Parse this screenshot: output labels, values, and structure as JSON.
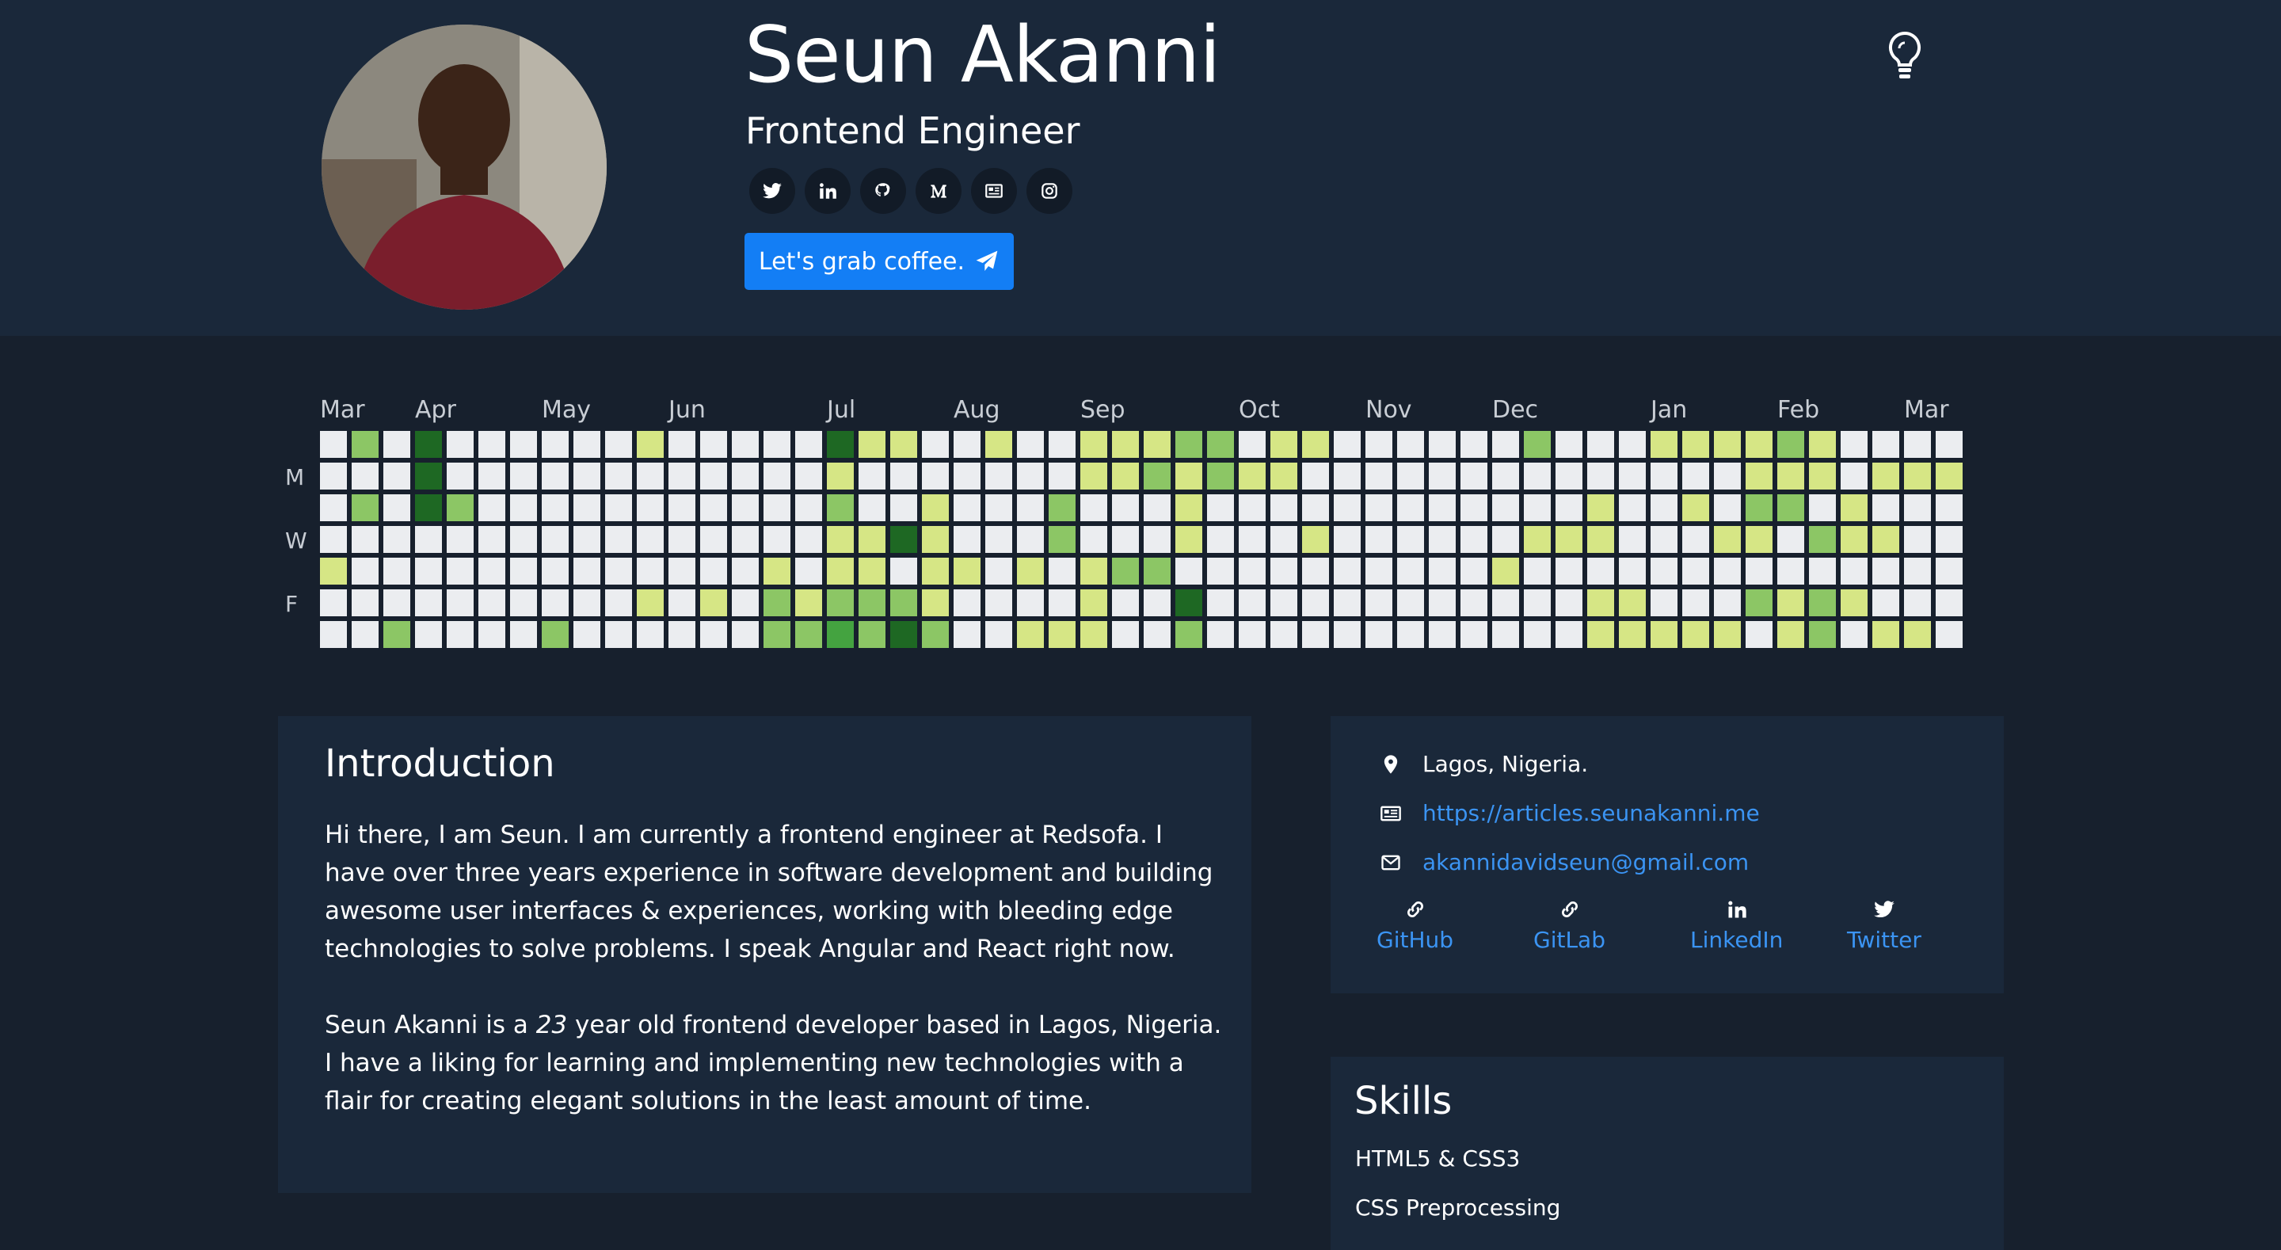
{
  "profile": {
    "name": "Seun Akanni",
    "role": "Frontend Engineer",
    "cta_label": "Let's grab coffee.",
    "socials": [
      "twitter-icon",
      "linkedin-icon",
      "github-icon",
      "medium-icon",
      "articles-icon",
      "instagram-icon"
    ]
  },
  "calendar": {
    "months": [
      "Mar",
      "Apr",
      "May",
      "Jun",
      "Jul",
      "Aug",
      "Sep",
      "Oct",
      "Nov",
      "Dec",
      "Jan",
      "Feb",
      "Mar"
    ],
    "day_labels": [
      "M",
      "W",
      "F"
    ],
    "level_colors": [
      "#ebedf0",
      "#d6e685",
      "#8cc665",
      "#44a340",
      "#1e6823"
    ],
    "weeks": [
      [
        0,
        0,
        0,
        0,
        1,
        0,
        0
      ],
      [
        2,
        0,
        2,
        0,
        0,
        0,
        0
      ],
      [
        0,
        0,
        0,
        0,
        0,
        0,
        2
      ],
      [
        4,
        4,
        4,
        0,
        0,
        0,
        0
      ],
      [
        0,
        0,
        2,
        0,
        0,
        0,
        0
      ],
      [
        0,
        0,
        0,
        0,
        0,
        0,
        0
      ],
      [
        0,
        0,
        0,
        0,
        0,
        0,
        0
      ],
      [
        0,
        0,
        0,
        0,
        0,
        0,
        2
      ],
      [
        0,
        0,
        0,
        0,
        0,
        0,
        0
      ],
      [
        0,
        0,
        0,
        0,
        0,
        0,
        0
      ],
      [
        1,
        0,
        0,
        0,
        0,
        1,
        0
      ],
      [
        0,
        0,
        0,
        0,
        0,
        0,
        0
      ],
      [
        0,
        0,
        0,
        0,
        0,
        1,
        0
      ],
      [
        0,
        0,
        0,
        0,
        0,
        0,
        0
      ],
      [
        0,
        0,
        0,
        0,
        1,
        2,
        2
      ],
      [
        0,
        0,
        0,
        0,
        0,
        1,
        2
      ],
      [
        4,
        1,
        2,
        1,
        1,
        2,
        3
      ],
      [
        1,
        0,
        0,
        1,
        1,
        2,
        2
      ],
      [
        1,
        0,
        0,
        4,
        0,
        2,
        4
      ],
      [
        0,
        0,
        1,
        1,
        1,
        1,
        2
      ],
      [
        0,
        0,
        0,
        0,
        1,
        0,
        0
      ],
      [
        1,
        0,
        0,
        0,
        0,
        0,
        0
      ],
      [
        0,
        0,
        0,
        0,
        1,
        0,
        1
      ],
      [
        0,
        0,
        2,
        2,
        0,
        0,
        1
      ],
      [
        1,
        1,
        0,
        0,
        1,
        1,
        1
      ],
      [
        1,
        1,
        0,
        0,
        2,
        0,
        0
      ],
      [
        1,
        2,
        0,
        0,
        2,
        0,
        0
      ],
      [
        2,
        1,
        1,
        1,
        0,
        4,
        2
      ],
      [
        2,
        2,
        0,
        0,
        0,
        0,
        0
      ],
      [
        0,
        1,
        0,
        0,
        0,
        0,
        0
      ],
      [
        1,
        1,
        0,
        0,
        0,
        0,
        0
      ],
      [
        1,
        0,
        0,
        1,
        0,
        0,
        0
      ],
      [
        0,
        0,
        0,
        0,
        0,
        0,
        0
      ],
      [
        0,
        0,
        0,
        0,
        0,
        0,
        0
      ],
      [
        0,
        0,
        0,
        0,
        0,
        0,
        0
      ],
      [
        0,
        0,
        0,
        0,
        0,
        0,
        0
      ],
      [
        0,
        0,
        0,
        0,
        0,
        0,
        0
      ],
      [
        0,
        0,
        0,
        0,
        1,
        0,
        0
      ],
      [
        2,
        0,
        0,
        1,
        0,
        0,
        0
      ],
      [
        0,
        0,
        0,
        1,
        0,
        0,
        0
      ],
      [
        0,
        0,
        1,
        1,
        0,
        1,
        1
      ],
      [
        0,
        0,
        0,
        0,
        0,
        1,
        1
      ],
      [
        1,
        0,
        0,
        0,
        0,
        0,
        1
      ],
      [
        1,
        0,
        1,
        0,
        0,
        0,
        1
      ],
      [
        1,
        0,
        0,
        1,
        0,
        0,
        1
      ],
      [
        1,
        1,
        2,
        1,
        0,
        2,
        0
      ],
      [
        2,
        1,
        2,
        0,
        0,
        1,
        1
      ],
      [
        1,
        1,
        0,
        2,
        0,
        2,
        2
      ],
      [
        0,
        0,
        1,
        1,
        0,
        1,
        0
      ],
      [
        0,
        1,
        0,
        1,
        0,
        0,
        1
      ],
      [
        0,
        1,
        0,
        0,
        0,
        0,
        1
      ],
      [
        0,
        1,
        0,
        0,
        0,
        0,
        0
      ]
    ]
  },
  "intro": {
    "title": "Introduction",
    "p1": "Hi there, I am Seun. I am currently a frontend engineer at Redsofa. I have over three years experience in software development and building awesome user interfaces & experiences, working with bleeding edge technologies to solve problems. I speak Angular and React right now.",
    "p2_before": "Seun Akanni is a ",
    "age": "23",
    "p2_after": " year old frontend developer based in Lagos, Nigeria. I have a liking for learning and implementing new technologies with a flair for creating elegant solutions in the least amount of time."
  },
  "contact": {
    "location": "Lagos, Nigeria.",
    "website": "https://articles.seunakanni.me",
    "email": "akannidavidseun@gmail.com",
    "links": [
      {
        "label": "GitHub",
        "icon": "link-icon"
      },
      {
        "label": "GitLab",
        "icon": "link-icon"
      },
      {
        "label": "LinkedIn",
        "icon": "linkedin-icon"
      },
      {
        "label": "Twitter",
        "icon": "twitter-icon"
      }
    ]
  },
  "skills": {
    "title": "Skills",
    "items": [
      "HTML5 & CSS3",
      "CSS Preprocessing"
    ]
  },
  "accent_color": "#137ef5",
  "link_color": "#3b94f3"
}
